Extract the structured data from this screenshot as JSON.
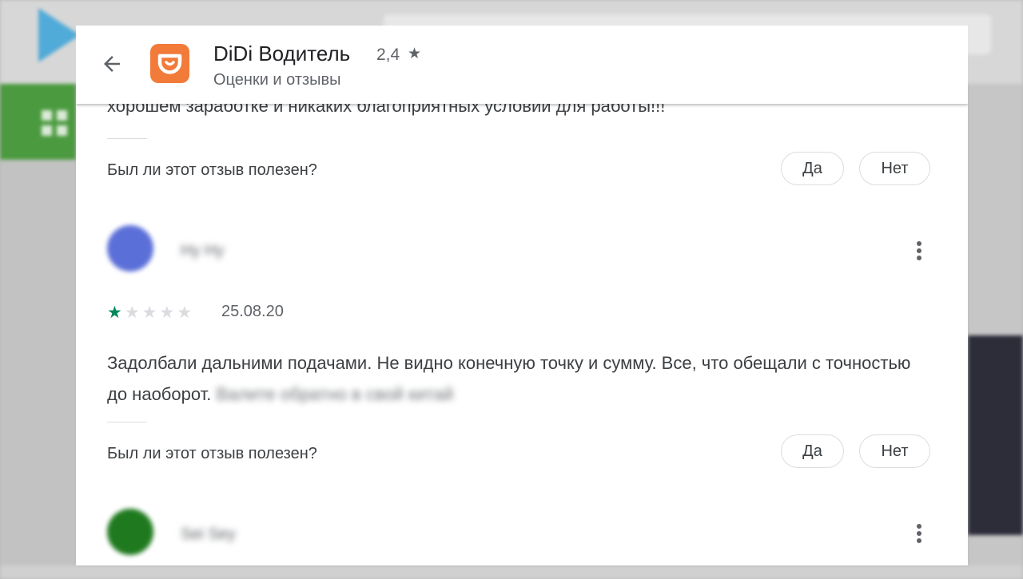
{
  "app": {
    "title": "DiDi Водитель",
    "rating": "2,4",
    "subtitle": "Оценки и отзывы",
    "accent": "#f27b3a"
  },
  "reviews": {
    "prev_fragment": "хорошем заработке и никаких благоприятных условий для работы!!!",
    "prev_fragment_right": "",
    "helpful_question": "Был ли этот отзыв полезен?",
    "yes_label": "Да",
    "no_label": "Нет",
    "items": [
      {
        "author": "Ну Ну",
        "avatar_color": "#5b6fd8",
        "rating": 1,
        "date": "25.08.20",
        "text": "Задолбали дальними подачами. Не видно конечную точку и сумму. Все, что обещали с точностью до наоборот.",
        "text_blurred": "Валите обратно в свой китай"
      },
      {
        "author": "Sei Sey",
        "avatar_color": "#1f7a1f"
      }
    ]
  },
  "icons": {
    "back": "arrow-back-icon",
    "star": "star-icon",
    "more": "more-vert-icon"
  }
}
